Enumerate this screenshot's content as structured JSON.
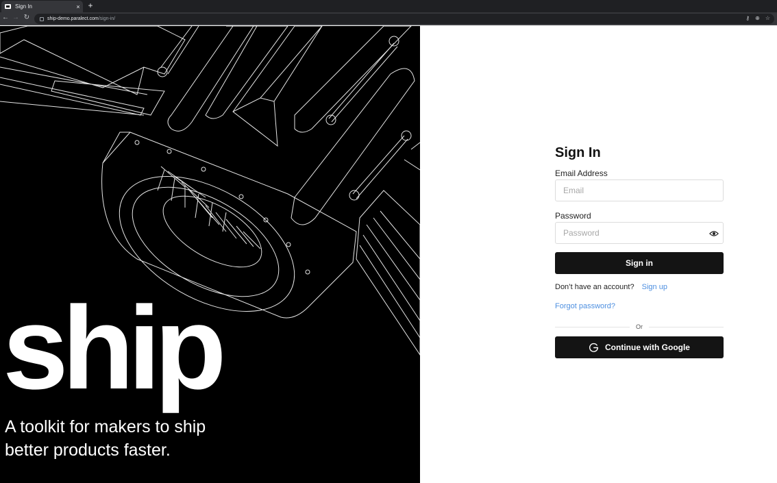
{
  "browser": {
    "tab_title": "Sign In",
    "tab_close": "×",
    "new_tab": "+",
    "url_host": "ship-demo.paralect.com",
    "url_path": "/sign-in/",
    "icons": [
      "back-icon",
      "forward-icon",
      "reload-icon",
      "key-icon",
      "zoom-icon",
      "star-icon"
    ]
  },
  "hero": {
    "wordmark": "ship",
    "tagline": "A toolkit for makers to ship better products faster."
  },
  "form": {
    "title": "Sign In",
    "email_label": "Email Address",
    "email_placeholder": "Email",
    "password_label": "Password",
    "password_placeholder": "Password",
    "signin_button": "Sign in",
    "no_account_text": "Don’t have an account?",
    "signup_link": "Sign up",
    "forgot_link": "Forgot password?",
    "divider_text": "Or",
    "google_button": "Continue with Google"
  },
  "colors": {
    "hero_bg": "#000000",
    "button_bg": "#141414",
    "link": "#4d8fe0"
  }
}
